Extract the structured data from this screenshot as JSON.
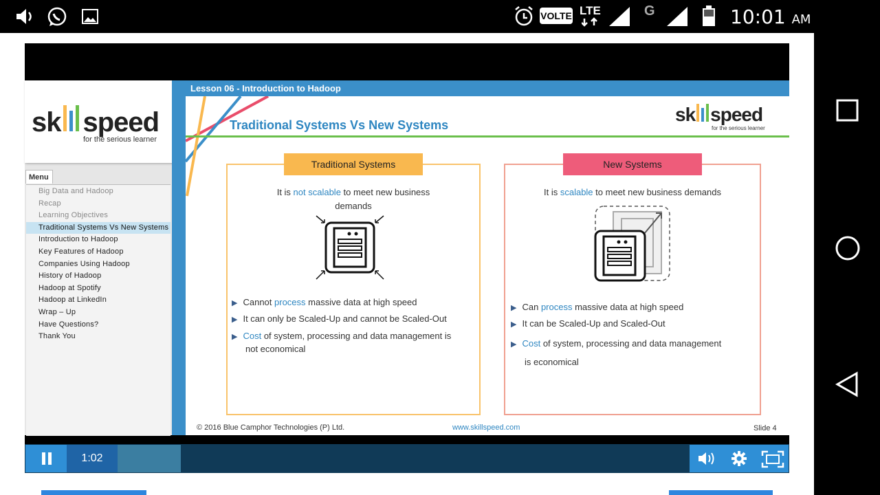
{
  "status_bar": {
    "time": "10:01",
    "ampm": "AM",
    "network_badge": "VOLTE",
    "lte_label": "LTE",
    "g_label": "G"
  },
  "logo": {
    "brand_pre": "sk",
    "brand_post": "speed",
    "tagline": "for the serious learner"
  },
  "menu": {
    "tab_label": "Menu",
    "items": [
      {
        "label": "Big Data and Hadoop",
        "state": "done"
      },
      {
        "label": "Recap",
        "state": "done"
      },
      {
        "label": "Learning Objectives",
        "state": "done"
      },
      {
        "label": "Traditional Systems Vs New Systems",
        "state": "active"
      },
      {
        "label": "Introduction to Hadoop",
        "state": "normal"
      },
      {
        "label": "Key Features of Hadoop",
        "state": "normal"
      },
      {
        "label": "Companies Using Hadoop",
        "state": "normal"
      },
      {
        "label": "History of Hadoop",
        "state": "normal"
      },
      {
        "label": "Hadoop at Spotify",
        "state": "normal"
      },
      {
        "label": "Hadoop at LinkedIn",
        "state": "normal"
      },
      {
        "label": "Wrap – Up",
        "state": "normal"
      },
      {
        "label": "Have Questions?",
        "state": "normal"
      },
      {
        "label": "Thank You",
        "state": "normal"
      }
    ]
  },
  "slide": {
    "lesson": "Lesson 06 - Introduction to Hadoop",
    "title": "Traditional Systems Vs New Systems",
    "logo_tagline": "for the serious learner",
    "traditional": {
      "header": "Traditional Systems",
      "lead_pre": "It is ",
      "lead_hl": "not scalable",
      "lead_post": " to meet new business",
      "lead_line2": "demands",
      "b1_pre": "Cannot ",
      "b1_hl": "process",
      "b1_post": " massive data at high speed",
      "b2": "It can only be Scaled-Up and cannot be Scaled-Out",
      "b3_hl": "Cost",
      "b3_post": " of system, processing and data management is",
      "b3_line2": "not economical"
    },
    "new": {
      "header": "New Systems",
      "lead_pre": "It is ",
      "lead_hl": "scalable",
      "lead_post": " to meet new business demands",
      "b1_pre": "Can ",
      "b1_hl": "process",
      "b1_post": " massive data at high speed",
      "b2": "It can be Scaled-Up and Scaled-Out",
      "b3_hl": "Cost",
      "b3_post": " of system, processing and data management",
      "b3_line2": "is economical"
    },
    "footer_copyright": "© 2016 Blue Camphor Technologies (P) Ltd.",
    "footer_url": "www.skillspeed.com",
    "slide_number": "Slide 4"
  },
  "player": {
    "elapsed": "1:02",
    "progress_fraction": 0.11
  },
  "colors": {
    "accent_blue": "#3b8fc9",
    "trad_header": "#f9b84f",
    "new_header": "#ee5c7a",
    "green_rule": "#6abf4b"
  }
}
